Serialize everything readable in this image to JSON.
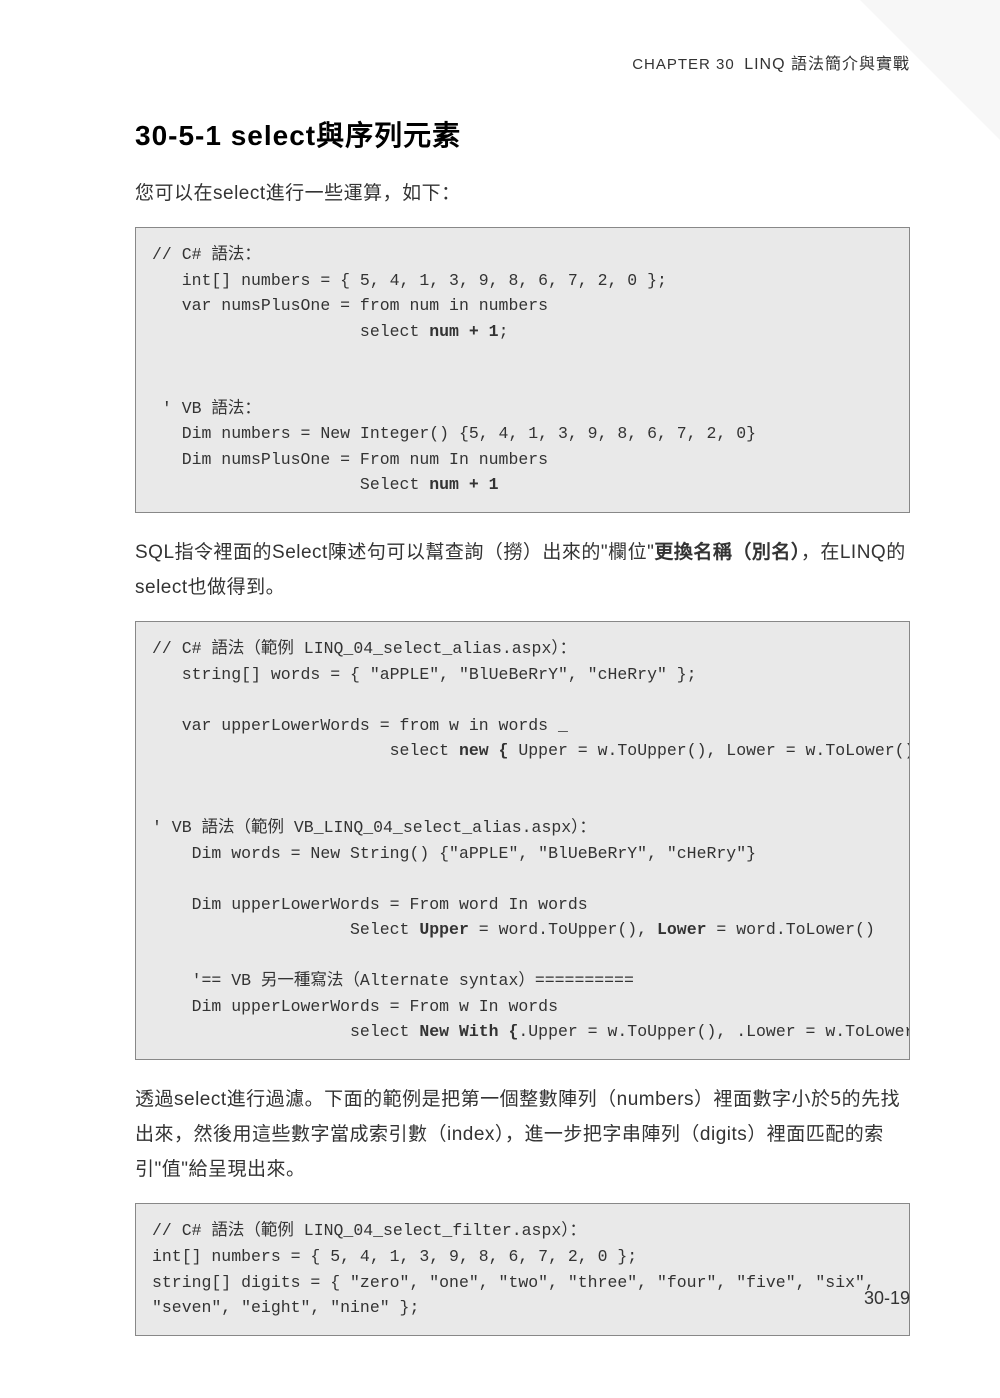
{
  "header": {
    "chapter_label": "CHAPTER 30",
    "chapter_title": "LINQ 語法簡介與實戰"
  },
  "section": {
    "number": "30-5-1",
    "title": "select與序列元素"
  },
  "para1": "您可以在select進行一些運算，如下：",
  "code1": {
    "l1": "// C# 語法：",
    "l2": "   int[] numbers = { 5, 4, 1, 3, 9, 8, 6, 7, 2, 0 };",
    "l3": "   var numsPlusOne = from num in numbers",
    "l4_pre": "                     select ",
    "l4_bold": "num + 1",
    "l4_post": ";",
    "l5": "",
    "l6": "",
    "l7": " ' VB 語法：",
    "l8": "   Dim numbers = New Integer() {5, 4, 1, 3, 9, 8, 6, 7, 2, 0}",
    "l9": "   Dim numsPlusOne = From num In numbers",
    "l10_pre": "                     Select ",
    "l10_bold": "num + 1"
  },
  "para2_a": "SQL指令裡面的Select陳述句可以幫查詢（撈）出來的\"欄位\"",
  "para2_b": "更換名稱（別名）",
  "para2_c": "，在LINQ的select也做得到。",
  "code2": {
    "l1": "// C# 語法（範例 LINQ_04_select_alias.aspx）：",
    "l2": "   string[] words = { \"aPPLE\", \"BlUeBeRrY\", \"cHeRry\" };",
    "l3": "",
    "l4": "   var upperLowerWords = from w in words _",
    "l5_pre": "                        select ",
    "l5_b1": "new {",
    "l5_mid": " Upper = w.ToUpper(), Lower = w.ToLower() ",
    "l5_b2": "}",
    "l5_post": ";",
    "l6": "",
    "l7": "",
    "l8": "' VB 語法（範例 VB_LINQ_04_select_alias.aspx）：",
    "l9": "    Dim words = New String() {\"aPPLE\", \"BlUeBeRrY\", \"cHeRry\"}",
    "l10": "",
    "l11": "    Dim upperLowerWords = From word In words",
    "l12_pre": "                    Select ",
    "l12_b1": "Upper",
    "l12_mid1": " = word.ToUpper(), ",
    "l12_b2": "Lower",
    "l12_mid2": " = word.ToLower()",
    "l13": "",
    "l14": "    '== VB 另一種寫法（Alternate syntax）==========",
    "l15": "    Dim upperLowerWords = From w In words",
    "l16_pre": "                    select ",
    "l16_b": "New With {",
    "l16_mid": ".Upper = w.ToUpper(), .Lower = w.ToLower() ",
    "l16_b2": "}"
  },
  "para3": "透過select進行過濾。下面的範例是把第一個整數陣列（numbers）裡面數字小於5的先找出來，然後用這些數字當成索引數（index），進一步把字串陣列（digits）裡面匹配的索引\"值\"給呈現出來。",
  "code3": {
    "l1": "// C# 語法（範例 LINQ_04_select_filter.aspx）：",
    "l2": "int[] numbers = { 5, 4, 1, 3, 9, 8, 6, 7, 2, 0 };",
    "l3": "string[] digits = { \"zero\", \"one\", \"two\", \"three\", \"four\", \"five\", \"six\",",
    "l4": "\"seven\", \"eight\", \"nine\" };"
  },
  "page_number": "30-19"
}
